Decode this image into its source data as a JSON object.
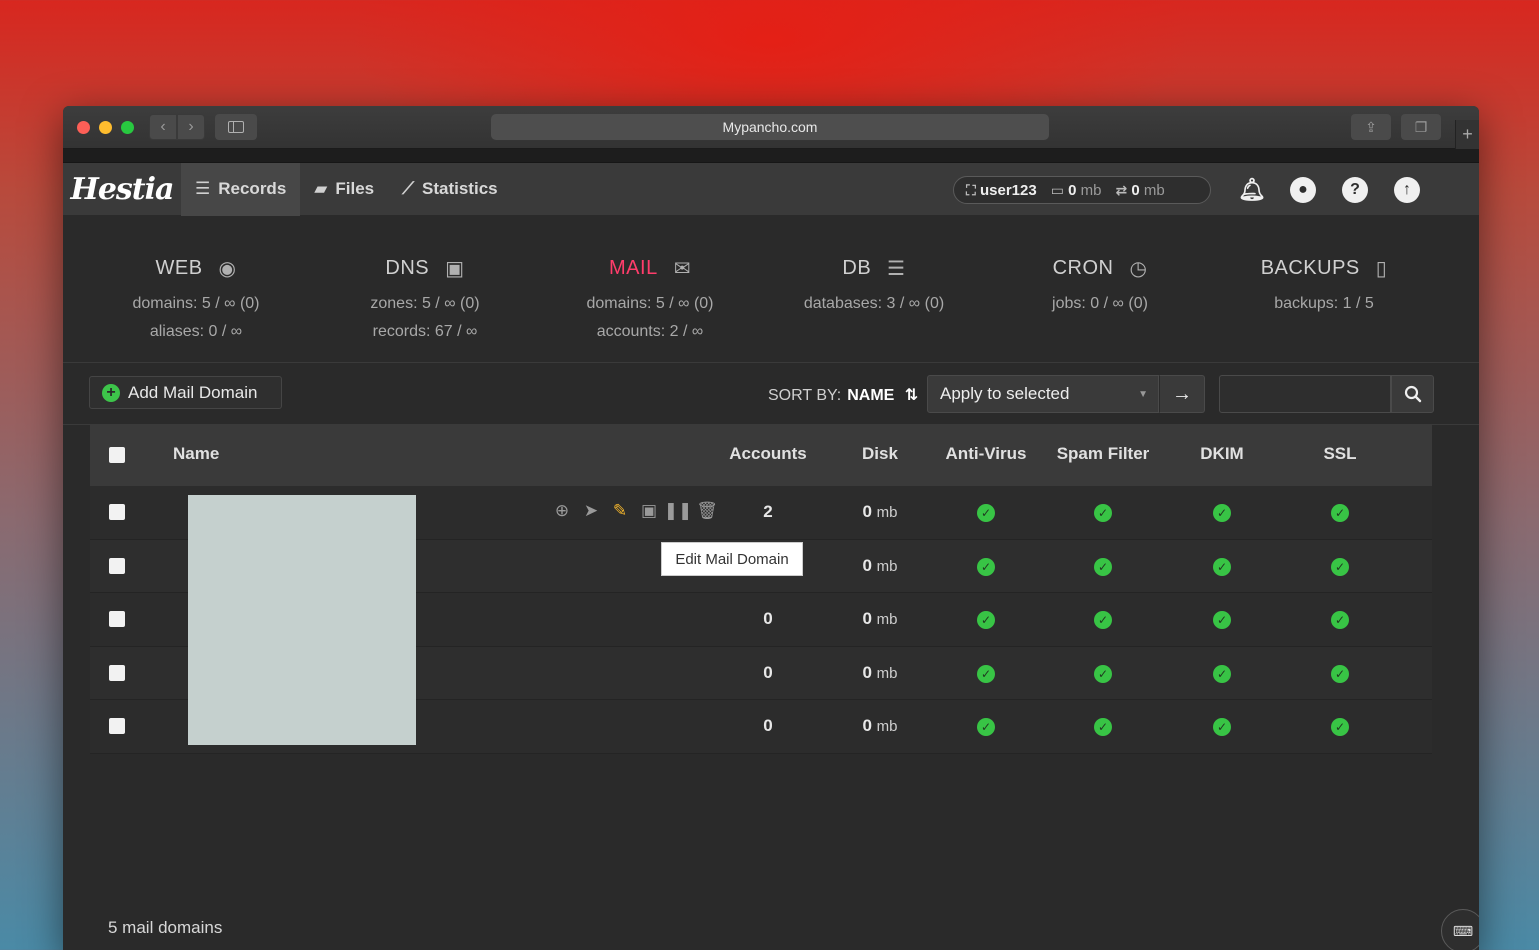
{
  "browser": {
    "url": "Mypancho.com"
  },
  "nav": {
    "logo": "Hestia",
    "items": [
      {
        "label": "Records",
        "icon": "list-icon",
        "active": true
      },
      {
        "label": "Files",
        "icon": "folder-icon",
        "active": false
      },
      {
        "label": "Statistics",
        "icon": "chart-icon",
        "active": false
      }
    ],
    "user": "user123",
    "disk": "0",
    "disk_unit": "mb",
    "bandwidth": "0",
    "bandwidth_unit": "mb"
  },
  "stats": [
    {
      "title": "WEB",
      "icon": "globe-icon",
      "line1": "domains: 5 / ∞ (0)",
      "line2": "aliases: 0 / ∞",
      "active": false
    },
    {
      "title": "DNS",
      "icon": "book-icon",
      "line1": "zones: 5 / ∞ (0)",
      "line2": "records: 67 / ∞",
      "active": false
    },
    {
      "title": "MAIL",
      "icon": "mail-icon",
      "line1": "domains: 5 / ∞ (0)",
      "line2": "accounts: 2 / ∞",
      "active": true
    },
    {
      "title": "DB",
      "icon": "database-icon",
      "line1": "databases: 3 / ∞ (0)",
      "line2": "",
      "active": false
    },
    {
      "title": "CRON",
      "icon": "clock-icon",
      "line1": "jobs: 0 / ∞ (0)",
      "line2": "",
      "active": false
    },
    {
      "title": "BACKUPS",
      "icon": "file-archive-icon",
      "line1": "backups: 1 / 5",
      "line2": "",
      "active": false
    }
  ],
  "toolbar": {
    "add_label": "Add Mail Domain",
    "sort_label": "SORT BY:",
    "sort_value": "NAME",
    "apply_placeholder": "Apply to selected"
  },
  "table": {
    "headers": {
      "name": "Name",
      "accounts": "Accounts",
      "disk": "Disk",
      "antivirus": "Anti-Virus",
      "spam": "Spam Filter",
      "dkim": "DKIM",
      "ssl": "SSL"
    },
    "rows": [
      {
        "accounts": "2",
        "disk": "0",
        "disk_unit": "mb"
      },
      {
        "accounts": "",
        "disk": "0",
        "disk_unit": "mb"
      },
      {
        "accounts": "0",
        "disk": "0",
        "disk_unit": "mb"
      },
      {
        "accounts": "0",
        "disk": "0",
        "disk_unit": "mb"
      },
      {
        "accounts": "0",
        "disk": "0",
        "disk_unit": "mb"
      }
    ]
  },
  "tooltip": "Edit Mail Domain",
  "footer": {
    "count": "5 mail domains"
  },
  "colors": {
    "accent_active": "#ff3d6b",
    "ok_green": "#38c445",
    "edit_yellow": "#f3b52c"
  }
}
